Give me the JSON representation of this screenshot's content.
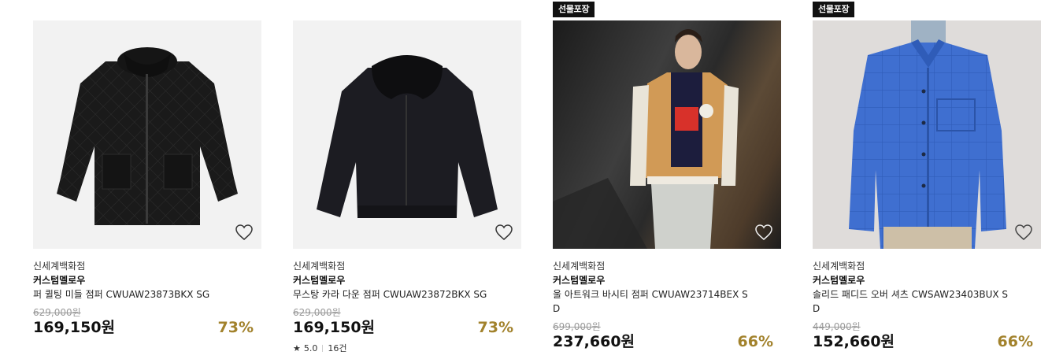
{
  "products": [
    {
      "badge": "",
      "store": "신세계백화점",
      "brand": "커스텀멜로우",
      "name": "퍼 퀼팅 미들 점퍼 CWUAW23873BKX SG",
      "original_price": "629,000원",
      "price": "169,150원",
      "discount": "73%",
      "rating": "",
      "review_count": "",
      "image": "black-quilted-jacket"
    },
    {
      "badge": "",
      "store": "신세계백화점",
      "brand": "커스텀멜로우",
      "name": "무스탕 카라 다운 점퍼 CWUAW23872BKX SG",
      "original_price": "629,000원",
      "price": "169,150원",
      "discount": "73%",
      "rating": "5.0",
      "review_count": "16건",
      "image": "black-shearling-collar-jacket"
    },
    {
      "badge": "선물포장",
      "store": "신세계백화점",
      "brand": "커스텀멜로우",
      "name": "울 아트워크 바시티 점퍼 CWUAW23714BEX SD",
      "original_price": "699,000원",
      "price": "237,660원",
      "discount": "66%",
      "rating": "",
      "review_count": "",
      "image": "model-varsity-jacket"
    },
    {
      "badge": "선물포장",
      "store": "신세계백화점",
      "brand": "커스텀멜로우",
      "name": "솔리드 패디드 오버 셔츠 CWSAW23403BUX SD",
      "original_price": "449,000원",
      "price": "152,660원",
      "discount": "66%",
      "rating": "",
      "review_count": "",
      "image": "model-blue-padded-shirt"
    }
  ],
  "colors": {
    "discount": "#a2822c",
    "badge_bg": "#111111",
    "original_price": "#9a9a9a"
  },
  "icons": {
    "wishlist": "heart-outline-icon",
    "rating": "star-icon"
  }
}
